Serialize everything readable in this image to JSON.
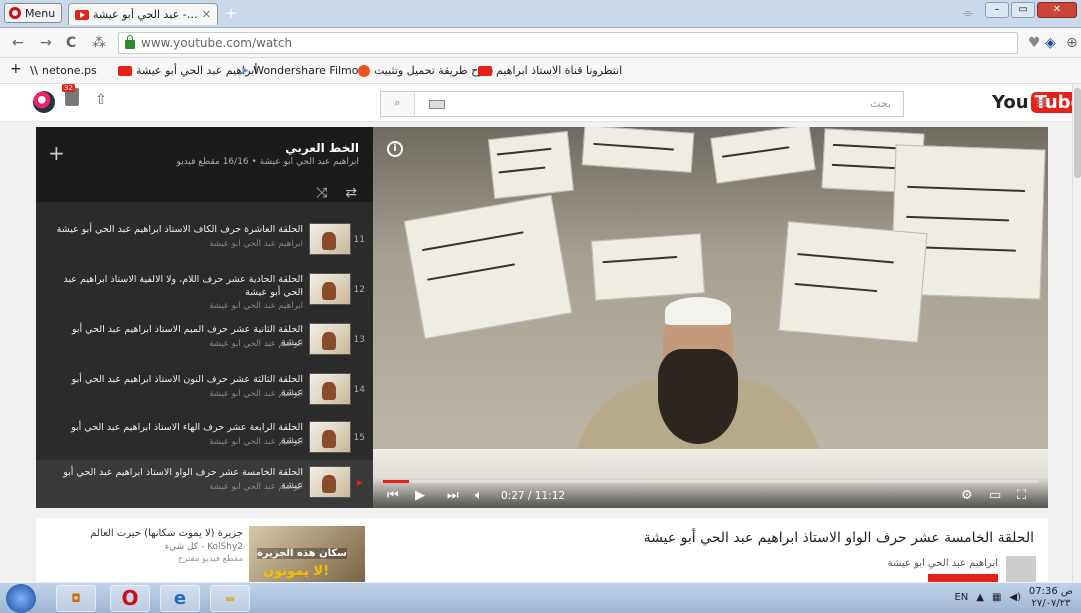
{
  "browser": {
    "menu_label": "Menu",
    "tab_title": "عبد الحي أبو عيشة - YouTube",
    "url": "www.youtube.com/watch",
    "bookmarks": [
      "netone.ps",
      "أبراهيم عبد الحي أبو عيشة",
      "Wondershare Filmora",
      "شرح طريقة تحميل وتثبيت",
      "انتظرونا قناة الاستاذ ابراهيم"
    ]
  },
  "youtube": {
    "search_placeholder": "بحث",
    "logo_you": "You",
    "logo_tube": "Tube",
    "notification_count": "32"
  },
  "playlist": {
    "title": "الخط العربي",
    "subtitle": "ابراهيم عبد الحي ابو عيشة • 16/16 مقطع فيديو",
    "items": [
      {
        "num": "11",
        "title": "الحلقة العاشرة حرف الكاف الاستاذ ابراهيم عبد الحي أبو عيشة",
        "author": "ابراهيم عبد الحي ابو عيشة"
      },
      {
        "num": "12",
        "title": "الحلقة الحادية عشر حرف اللام، ولا الالفية الاستاذ ابراهيم عبد الحي أبو عيشة",
        "author": "ابراهيم عبد الحي ابو عيشة"
      },
      {
        "num": "13",
        "title": "الحلقة الثانية عشر حرف الميم الاستاذ ابراهيم عبد الحي أبو عيشة",
        "author": "ابراهيم عبد الحي ابو عيشة"
      },
      {
        "num": "14",
        "title": "الحلقة الثالثة عشر حرف النون الاستاذ ابراهيم عبد الحي أبو عيشة",
        "author": "ابراهيم عبد الحي ابو عيشة"
      },
      {
        "num": "15",
        "title": "الحلقة الرابعة عشر حرف الهاء الاستاذ ابراهيم عبد الحي أبو عيشة",
        "author": "ابراهيم عبد الحي ابو عيشة"
      },
      {
        "num": "",
        "title": "الحلقة الخامسة عشر حرف الواو الاستاذ ابراهيم عبد الحي أبو عيشة",
        "author": "ابراهيم عبد الحي ابو عيشة",
        "active": true
      }
    ]
  },
  "player": {
    "time": "0:27 / 11:12",
    "progress_fraction": 0.04
  },
  "video_info": {
    "title": "الحلقة الخامسة عشر حرف الواو الاستاذ ابراهيم عبد الحي أبو عيشة",
    "channel": "ابراهيم عبد الحي ابو عيشة"
  },
  "suggestion": {
    "title": "جزيرة (لا يموت سكانها) حيرت العالم",
    "channel": "KolShy2 - كل شيء",
    "meta": "مقطع فيديو مقترح",
    "thumb_line1": "سكان هذه الجزيرة",
    "thumb_line2": "لا يموتون!"
  },
  "taskbar": {
    "lang": "EN",
    "time": "07:36 ص",
    "date": "٢٧/٠٧/٢٣"
  },
  "colors": {
    "accent": "#e62117",
    "taskbar": "#b0c6e2"
  }
}
